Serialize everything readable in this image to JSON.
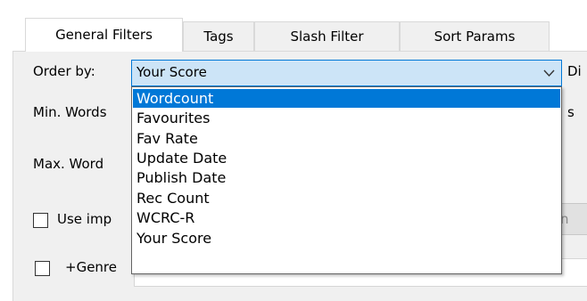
{
  "tabs": [
    {
      "label": "General Filters",
      "active": true
    },
    {
      "label": "Tags",
      "active": false
    },
    {
      "label": "Slash Filter",
      "active": false
    },
    {
      "label": "Sort Params",
      "active": false
    }
  ],
  "order_by": {
    "label": "Order by:",
    "selected": "Your Score",
    "trailing_label": "Di"
  },
  "fields": {
    "min_words_label": "Min. Words",
    "max_words_label": "Max. Word",
    "min_words_trailing": "s"
  },
  "checkboxes": {
    "use_imp_label": "Use imp",
    "genre_label": "+Genre",
    "use_imp_trailing": "n"
  },
  "dropdown": {
    "options": [
      "Wordcount",
      "Favourites",
      "Fav Rate",
      "Update Date",
      "Publish Date",
      "Rec Count",
      "WCRC-R",
      "Your Score"
    ],
    "highlighted_index": 0
  },
  "colors": {
    "accent": "#0078d7",
    "combo_bg": "#cce4f7",
    "panel_bg": "#f0f0f0"
  }
}
